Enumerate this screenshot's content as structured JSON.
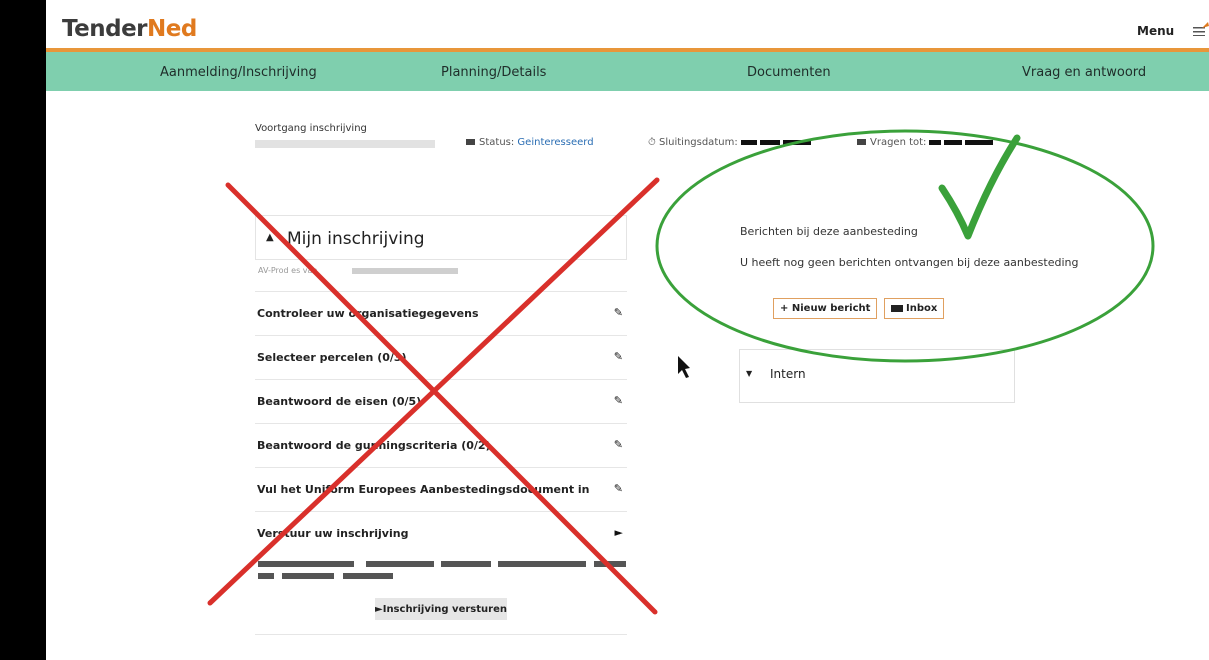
{
  "logo": {
    "part1": "Tender",
    "part2": "Ned"
  },
  "header": {
    "menu_label": "Menu"
  },
  "nav": {
    "items": [
      "Aanmelding/Inschrijving",
      "Planning/Details",
      "Documenten",
      "Vraag en antwoord"
    ]
  },
  "progress": {
    "label": "Voortgang inschrijving"
  },
  "status": {
    "label": "Status:",
    "value": "Geinteresseerd"
  },
  "deadline": {
    "label": "Sluitingsdatum:"
  },
  "questions_until": {
    "label": "Vragen tot:"
  },
  "mijn_inschrijving": {
    "title": "Mijn inschrijving",
    "subtitle": "AV-Prod  es van"
  },
  "steps": [
    {
      "label": "Controleer uw organisatiegegevens",
      "icon": "pencil-icon"
    },
    {
      "label": "Selecteer percelen (0/3)",
      "icon": "pencil-icon"
    },
    {
      "label": "Beantwoord de eisen (0/5)",
      "icon": "pencil-icon"
    },
    {
      "label": "Beantwoord de gunningscriteria (0/2)",
      "icon": "pencil-icon"
    },
    {
      "label": "Vul het Uniform Europees Aanbestedingsdocument in",
      "icon": "pencil-icon"
    },
    {
      "label": "Verstuur uw inschrijving",
      "icon": "play-icon"
    }
  ],
  "submit_button": {
    "label": "Inschrijving versturen"
  },
  "berichten": {
    "title": "Berichten bij deze aanbesteding",
    "text": "U heeft nog geen berichten ontvangen bij deze aanbesteding",
    "new_button": "+ Nieuw bericht",
    "inbox_button": "Inbox"
  },
  "intern": {
    "label": "Intern"
  },
  "colors": {
    "accent": "#e07a1f",
    "nav_bg": "#7fcfae",
    "link": "#2a6db3",
    "cross": "#d9302b",
    "check": "#3aa13a"
  }
}
